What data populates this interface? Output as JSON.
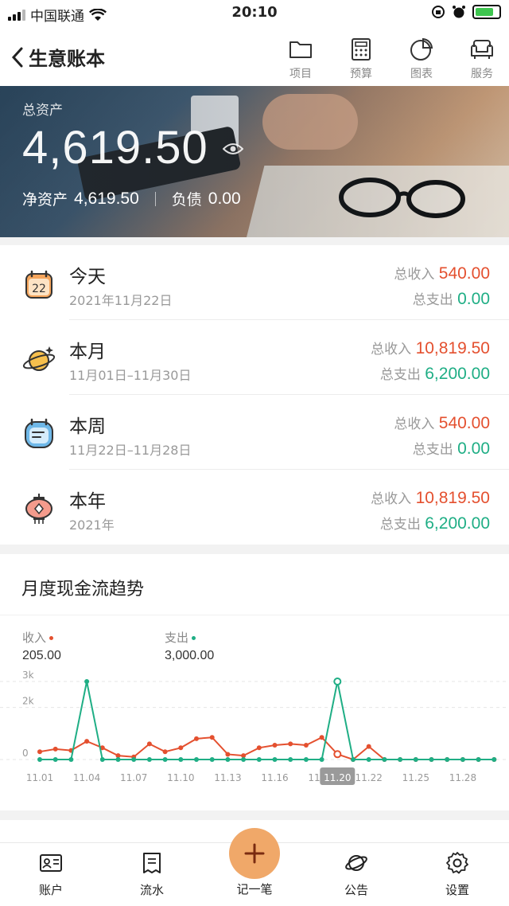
{
  "status": {
    "carrier": "中国联通",
    "time": "20:10"
  },
  "nav": {
    "title": "生意账本",
    "tools": [
      {
        "label": "项目",
        "icon": "folder-icon"
      },
      {
        "label": "预算",
        "icon": "calculator-icon"
      },
      {
        "label": "图表",
        "icon": "pie-chart-icon"
      },
      {
        "label": "服务",
        "icon": "sofa-icon"
      }
    ]
  },
  "hero": {
    "total_label": "总资产",
    "total": "4,619.50",
    "net_label": "净资产",
    "net": "4,619.50",
    "debt_label": "负债",
    "debt": "0.00"
  },
  "summary": [
    {
      "name": "今天",
      "date": "2021年11月22日",
      "income_label": "总收入",
      "income": "540.00",
      "expense_label": "总支出",
      "expense": "0.00",
      "icon": "calendar-icon"
    },
    {
      "name": "本月",
      "date": "11月01日–11月30日",
      "income_label": "总收入",
      "income": "10,819.50",
      "expense_label": "总支出",
      "expense": "6,200.00",
      "icon": "planet-icon"
    },
    {
      "name": "本周",
      "date": "11月22日–11月28日",
      "income_label": "总收入",
      "income": "540.00",
      "expense_label": "总支出",
      "expense": "0.00",
      "icon": "week-calendar-icon"
    },
    {
      "name": "本年",
      "date": "2021年",
      "income_label": "总收入",
      "income": "10,819.50",
      "expense_label": "总支出",
      "expense": "6,200.00",
      "icon": "lantern-icon"
    }
  ],
  "chart_card": {
    "title": "月度现金流趋势",
    "income_label": "收入",
    "income_value": "205.00",
    "expense_label": "支出",
    "expense_value": "3,000.00",
    "selected_tick": "11.20"
  },
  "colors": {
    "income": "#e4502f",
    "expense": "#1fae85",
    "fab": "#f0a869"
  },
  "chart_data": {
    "type": "line",
    "x": [
      "11.01",
      "11.02",
      "11.03",
      "11.04",
      "11.05",
      "11.06",
      "11.07",
      "11.08",
      "11.09",
      "11.10",
      "11.11",
      "11.12",
      "11.13",
      "11.14",
      "11.15",
      "11.16",
      "11.17",
      "11.18",
      "11.19",
      "11.20",
      "11.21",
      "11.22",
      "11.23",
      "11.24",
      "11.25",
      "11.26",
      "11.27",
      "11.28",
      "11.29",
      "11.30"
    ],
    "tick_labels": [
      "11.01",
      "11.04",
      "11.07",
      "11.10",
      "11.13",
      "11.16",
      "11.19",
      "11.20",
      "11.22",
      "11.25",
      "11.28"
    ],
    "y_ticks": [
      "3k",
      "2k",
      "0"
    ],
    "ylim": [
      0,
      3000
    ],
    "series": [
      {
        "name": "收入",
        "color": "#e4502f",
        "values": [
          300,
          400,
          350,
          700,
          450,
          150,
          100,
          600,
          300,
          450,
          800,
          850,
          200,
          150,
          450,
          550,
          600,
          550,
          850,
          205,
          0,
          500,
          0,
          0,
          0,
          0,
          0,
          0,
          0,
          0
        ]
      },
      {
        "name": "支出",
        "color": "#1fae85",
        "values": [
          0,
          0,
          0,
          3000,
          0,
          0,
          0,
          0,
          0,
          0,
          0,
          0,
          0,
          0,
          0,
          0,
          0,
          0,
          0,
          3000,
          0,
          0,
          0,
          0,
          0,
          0,
          0,
          0,
          0,
          0
        ]
      }
    ],
    "grid": true
  },
  "tabbar": {
    "items": [
      {
        "label": "账户",
        "icon": "account-card-icon"
      },
      {
        "label": "流水",
        "icon": "ledger-icon"
      },
      {
        "label": "记一笔",
        "icon": "plus-icon"
      },
      {
        "label": "公告",
        "icon": "planet-icon"
      },
      {
        "label": "设置",
        "icon": "gear-icon"
      }
    ]
  }
}
